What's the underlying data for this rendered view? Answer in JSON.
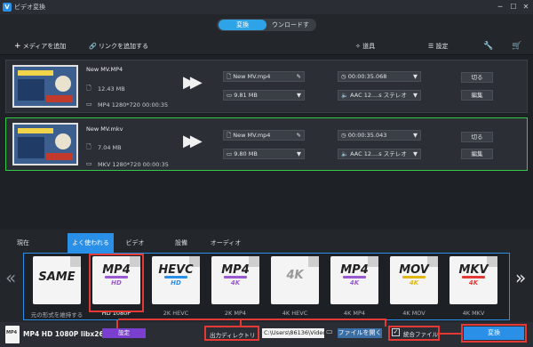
{
  "window": {
    "title": "ビデオ変換",
    "logo": "V",
    "minimize": "─",
    "maximize": "☐",
    "close": "✕"
  },
  "tabs": {
    "convert": "変換",
    "download": "ウンロードす"
  },
  "toolbar": {
    "add_media": "メディアを追加",
    "add_link": "リンクを追加する",
    "tools": "道具",
    "settings": "設定"
  },
  "files": [
    {
      "name": "New MV.MP4",
      "size": "12.43 MB",
      "info": "MP4 1280*720 00:00:35",
      "out_name": "New MV.mp4",
      "out_size": "9.81 MB",
      "duration": "00:00:35.068",
      "audio": "AAC 12....s ステレオ",
      "cut": "切る",
      "edit": "編集"
    },
    {
      "name": "New MV.mkv",
      "size": "7.04 MB",
      "info": "MKV 1280*720 00:00:35",
      "out_name": "New MV.mp4",
      "out_size": "9.80 MB",
      "duration": "00:00:35.043",
      "audio": "AAC 12....s ステレオ",
      "cut": "切る",
      "edit": "編集"
    }
  ],
  "format_tabs": [
    "現在",
    "よく使われる",
    "ビデオ",
    "設備",
    "オーディオ"
  ],
  "formats": [
    {
      "name": "SAME",
      "sub": "",
      "band": "",
      "caption": "元の形式を維持する"
    },
    {
      "name": "MP4",
      "sub": "HD",
      "band": "#9b59d0",
      "caption": "HD 1080P"
    },
    {
      "name": "HEVC",
      "sub": "HD",
      "band": "#2a8fe6",
      "caption": "2K HEVC"
    },
    {
      "name": "MP4",
      "sub": "4K",
      "band": "#9b59d0",
      "caption": "2K MP4"
    },
    {
      "name": "4K",
      "sub": "",
      "band": "",
      "caption": "4K HEVC"
    },
    {
      "name": "MP4",
      "sub": "4K",
      "band": "#9b59d0",
      "caption": "4K MP4"
    },
    {
      "name": "MOV",
      "sub": "4K",
      "band": "#e2b714",
      "caption": "4K MOV"
    },
    {
      "name": "MKV",
      "sub": "4K",
      "band": "#e53935",
      "caption": "4K MKV"
    }
  ],
  "bottom": {
    "profile": "MP4 HD 1080P libx264",
    "settings_btn": "設定",
    "output_dir_label": "出力ディレクトリ",
    "path": "C:\\Users\\86136\\Videc",
    "open_file": "ファイルを開く",
    "merge": "統合ファイル",
    "convert": "変換"
  },
  "colors": {
    "accent": "#2a8fe6",
    "highlight": "#e53935",
    "selected_border": "#35c94a"
  }
}
